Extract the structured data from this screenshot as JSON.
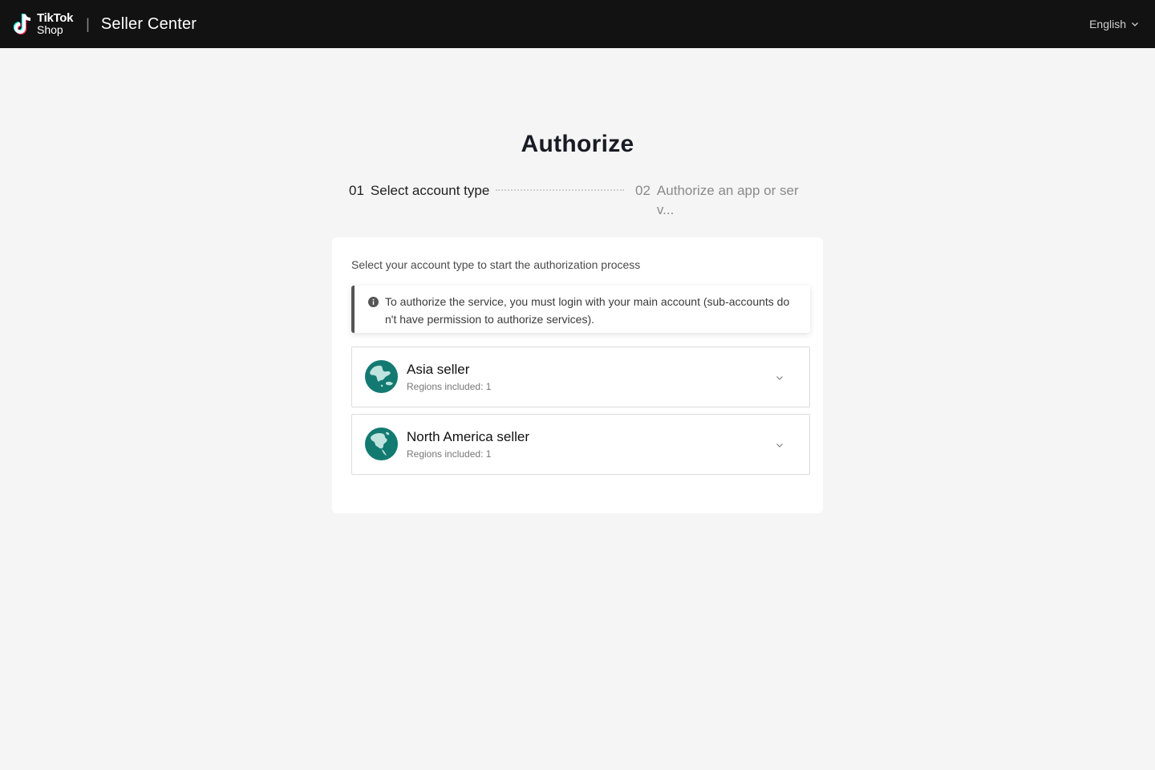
{
  "header": {
    "logo_line1": "TikTok",
    "logo_line2": "Shop",
    "separator": "|",
    "title": "Seller Center",
    "language": "English"
  },
  "page": {
    "title": "Authorize"
  },
  "steps": [
    {
      "number": "01",
      "label": "Select account type",
      "state": "active"
    },
    {
      "number": "02",
      "label": "Authorize an app or serv...",
      "state": "inactive"
    }
  ],
  "card": {
    "subtitle": "Select your account type to start the authorization process",
    "notice": "To authorize the service, you must login with your main account (sub-accounts don't have permission to authorize services).",
    "regions": [
      {
        "name": "Asia seller",
        "meta": "Regions included: 1",
        "icon": "asia-globe-icon"
      },
      {
        "name": "North America seller",
        "meta": "Regions included: 1",
        "icon": "north-america-globe-icon"
      }
    ]
  },
  "colors": {
    "header_bg": "#121212",
    "page_bg": "#f5f5f5",
    "globe": "#137a72"
  }
}
